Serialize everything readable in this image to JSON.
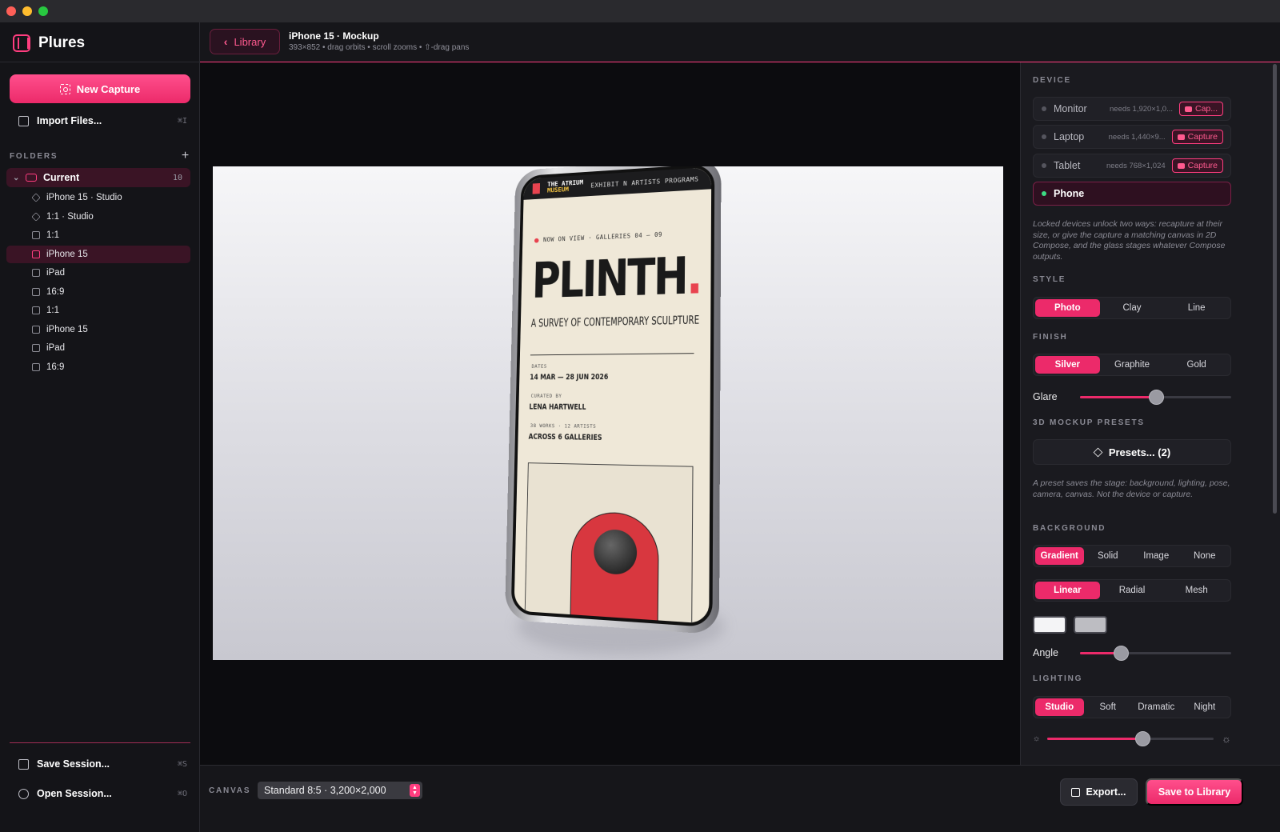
{
  "app": {
    "name": "Plures"
  },
  "sidebar": {
    "new_capture": "New Capture",
    "import_files": "Import Files...",
    "import_shortcut": "⌘I",
    "folders_label": "FOLDERS",
    "folder_current": {
      "label": "Current",
      "count": "10"
    },
    "items": [
      {
        "label": "iPhone 15 · Studio"
      },
      {
        "label": "1:1 · Studio"
      },
      {
        "label": "1:1"
      },
      {
        "label": "iPhone 15"
      },
      {
        "label": "iPad"
      },
      {
        "label": "16:9"
      },
      {
        "label": "1:1"
      },
      {
        "label": "iPhone 15"
      },
      {
        "label": "iPad"
      },
      {
        "label": "16:9"
      }
    ],
    "save_session": "Save Session...",
    "save_shortcut": "⌘S",
    "open_session": "Open Session...",
    "open_shortcut": "⌘O"
  },
  "header": {
    "library_button": "Library",
    "title": "iPhone 15 · Mockup",
    "subtitle": "393×852 • drag orbits • scroll zooms • ⇧-drag pans"
  },
  "preview": {
    "nav_brand_top": "THE ATRIUM",
    "nav_brand_bottom": "MUSEUM",
    "nav_links": "EXHIBIT N  ARTISTS  PROGRAMS",
    "on_view": "NOW ON VIEW · GALLERIES 04 — 09",
    "title": "PLINTH",
    "title_dot": ".",
    "subtitle": "A SURVEY OF CONTEMPORARY SCULPTURE",
    "dates_label": "DATES",
    "dates_value": "14 MAR — 28 JUN 2026",
    "curated_label": "CURATED BY",
    "curated_value": "LENA HARTWELL",
    "works_label": "38 WORKS · 12 ARTISTS",
    "works_value": "ACROSS 6 GALLERIES"
  },
  "bottombar": {
    "canvas_label": "CANVAS",
    "canvas_value": "Standard 8:5 · 3,200×2,000",
    "export": "Export...",
    "save_to_library": "Save to Library"
  },
  "panel": {
    "device_head": "DEVICE",
    "devices": [
      {
        "label": "Monitor",
        "need": "needs 1,920×1,0...",
        "action": "Cap..."
      },
      {
        "label": "Laptop",
        "need": "needs 1,440×9...",
        "action": "Capture"
      },
      {
        "label": "Tablet",
        "need": "needs 768×1,024",
        "action": "Capture"
      },
      {
        "label": "Phone"
      }
    ],
    "locked_note": "Locked devices unlock two ways: recapture at their size, or give the capture a matching canvas in 2D Compose, and the glass stages whatever Compose outputs.",
    "style_head": "STYLE",
    "style_options": [
      "Photo",
      "Clay",
      "Line"
    ],
    "finish_head": "FINISH",
    "finish_options": [
      "Silver",
      "Graphite",
      "Gold"
    ],
    "glare_label": "Glare",
    "glare_value": 0.5,
    "presets_head": "3D MOCKUP PRESETS",
    "presets_button": "Presets... (2)",
    "presets_note": "A preset saves the stage: background, lighting, pose, camera, canvas. Not the device or capture.",
    "background_head": "BACKGROUND",
    "background_options": [
      "Gradient",
      "Solid",
      "Image",
      "None"
    ],
    "gradient_options": [
      "Linear",
      "Radial",
      "Mesh"
    ],
    "swatch_colors": [
      "#f4f4f6",
      "#bdbdc2"
    ],
    "angle_label": "Angle",
    "angle_value": 0.27,
    "lighting_head": "LIGHTING",
    "lighting_options": [
      "Studio",
      "Soft",
      "Dramatic",
      "Night"
    ],
    "lighting_value": 0.57
  },
  "colors": {
    "accent": "#ec2a6a",
    "accent_light": "#ff5a8f",
    "success": "#3ddc84"
  }
}
